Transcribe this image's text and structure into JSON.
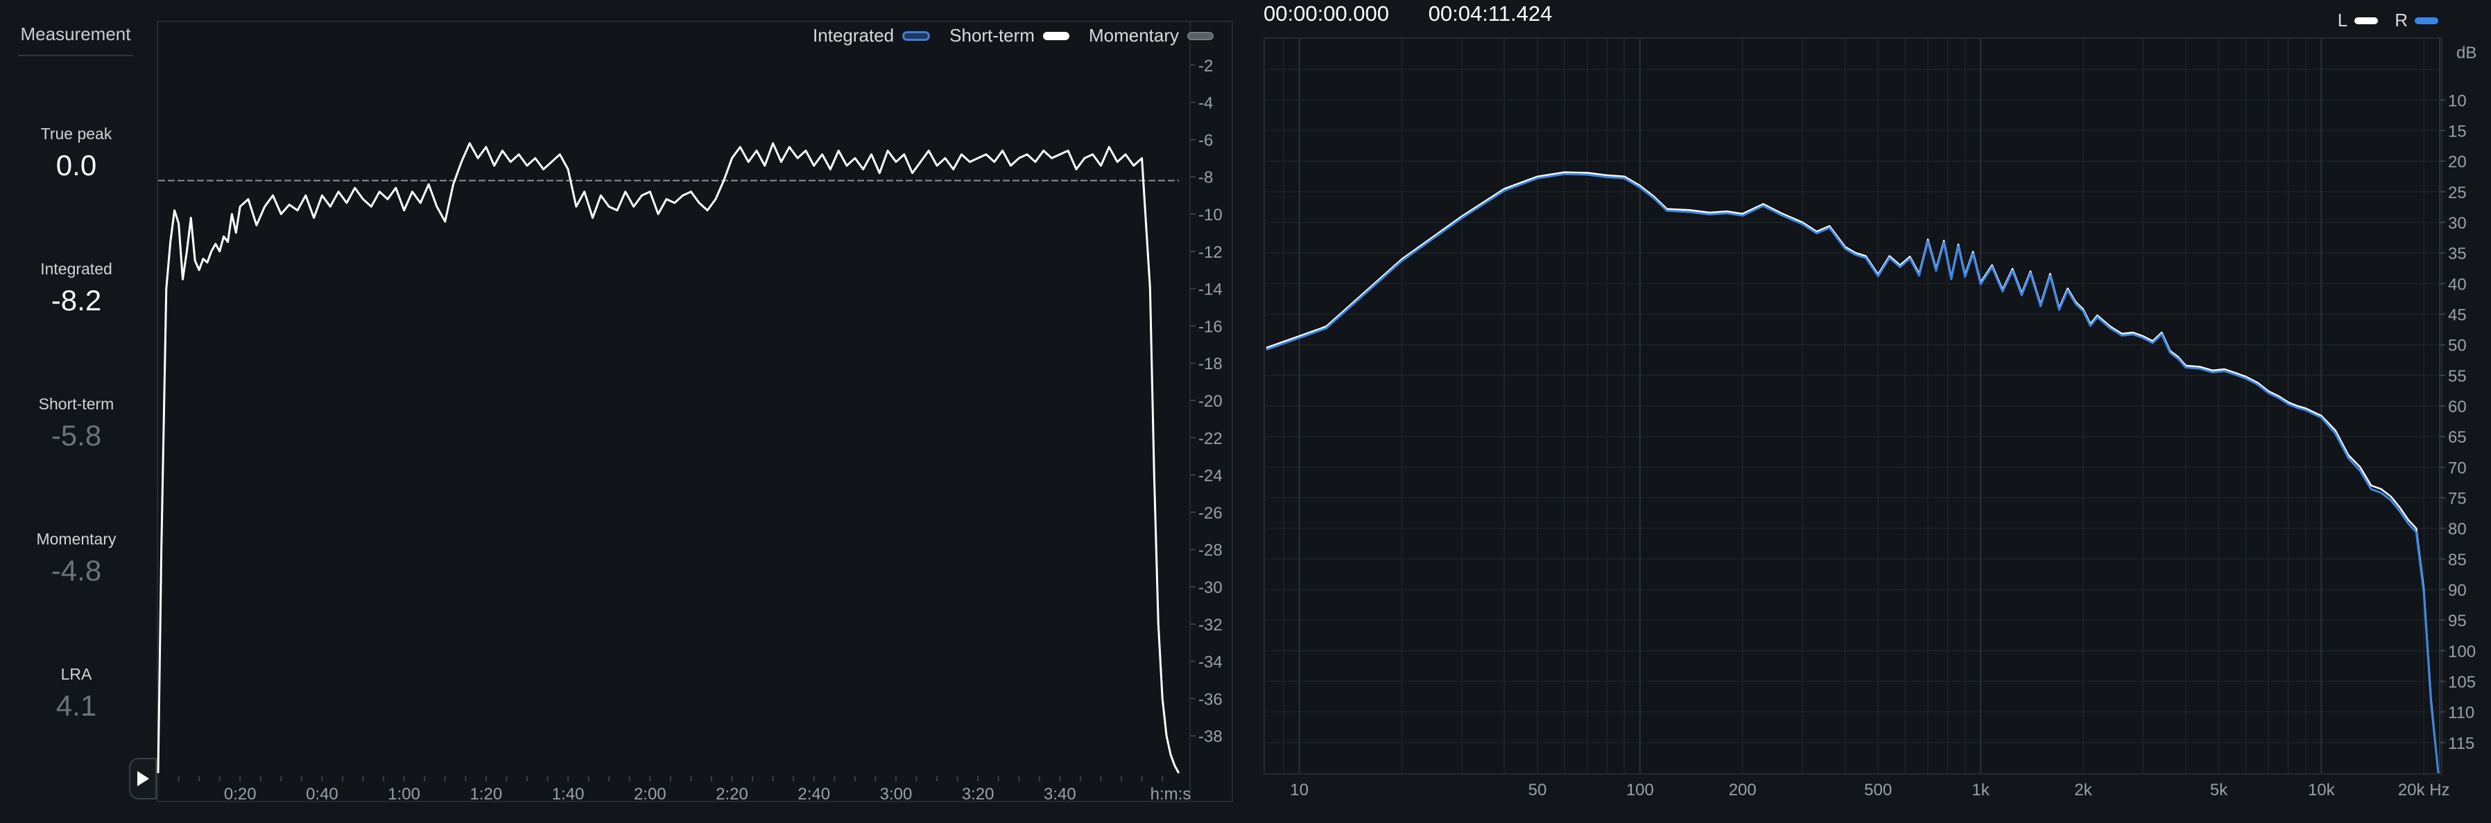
{
  "sidebar": {
    "title": "Measurement",
    "metrics": [
      {
        "label": "True peak",
        "value": "0.0"
      },
      {
        "label": "Integrated",
        "value": "-8.2"
      },
      {
        "label": "Short-term",
        "value": "-5.8"
      },
      {
        "label": "Momentary",
        "value": "-4.8"
      },
      {
        "label": "LRA",
        "value": "4.1"
      }
    ]
  },
  "loudness_legend": {
    "integrated": "Integrated",
    "short_term": "Short-term",
    "momentary": "Momentary"
  },
  "timecodes": {
    "start": "00:00:00.000",
    "end": "00:04:11.424"
  },
  "spectrum_legend": {
    "left": "L",
    "right": "R"
  },
  "colors": {
    "background": "#121519",
    "short_term_line": "#ffffff",
    "channel_l": "#ffffff",
    "channel_r": "#3b86e6",
    "integrated": "#3f7fd6",
    "momentary": "#737a82"
  },
  "icons": {
    "play": "play-icon"
  },
  "chart_data": [
    {
      "type": "line",
      "name": "loudness-history",
      "x_unit_label": "h:m:s",
      "x_tick_labels": [
        "0:20",
        "0:40",
        "1:00",
        "1:20",
        "1:40",
        "2:00",
        "2:20",
        "2:40",
        "3:00",
        "3:20",
        "3:40"
      ],
      "x_tick_seconds": [
        20,
        40,
        60,
        80,
        100,
        120,
        140,
        160,
        180,
        200,
        220
      ],
      "xlim_seconds": [
        0,
        251.4
      ],
      "y_ticks": [
        -2,
        -4,
        -6,
        -8,
        -10,
        -12,
        -14,
        -16,
        -18,
        -20,
        -22,
        -24,
        -26,
        -28,
        -30,
        -32,
        -34,
        -36,
        -38
      ],
      "ylim": [
        0,
        -40
      ],
      "integrated_reference": -8.2,
      "series": [
        {
          "x": [
            0,
            0.8,
            2,
            3,
            4,
            5,
            6,
            7,
            8,
            9,
            10,
            11,
            12,
            13,
            14,
            15,
            16,
            17,
            18,
            19,
            20,
            22,
            24,
            26,
            28,
            30,
            32,
            34,
            36,
            38,
            40,
            42,
            44,
            46,
            48,
            50,
            52,
            54,
            56,
            58,
            60,
            62,
            64,
            66,
            68,
            70,
            72,
            74,
            76,
            78,
            80,
            82,
            84,
            86,
            88,
            90,
            92,
            94,
            96,
            98,
            100,
            102,
            104,
            106,
            108,
            110,
            112,
            114,
            116,
            118,
            120,
            122,
            124,
            126,
            128,
            130,
            132,
            134,
            136,
            138,
            140,
            142,
            144,
            146,
            148,
            150,
            152,
            154,
            156,
            158,
            160,
            162,
            164,
            166,
            168,
            170,
            172,
            174,
            176,
            178,
            180,
            182,
            184,
            186,
            188,
            190,
            192,
            194,
            196,
            198,
            200,
            202,
            204,
            206,
            208,
            210,
            212,
            214,
            216,
            218,
            220,
            222,
            224,
            226,
            228,
            230,
            232,
            234,
            236,
            238,
            240,
            242,
            243,
            244,
            245,
            246,
            247,
            248,
            249
          ],
          "y": [
            -40,
            -28,
            -14,
            -11.5,
            -9.8,
            -10.5,
            -13.5,
            -12,
            -10.2,
            -12.5,
            -13,
            -12.4,
            -12.6,
            -12,
            -11.6,
            -12,
            -11.2,
            -11.5,
            -10,
            -11,
            -9.6,
            -9.2,
            -10.6,
            -9.6,
            -9,
            -10,
            -9.5,
            -9.8,
            -9,
            -10.2,
            -9,
            -9.6,
            -8.8,
            -9.4,
            -8.6,
            -9.2,
            -9.6,
            -8.8,
            -9.2,
            -8.6,
            -9.8,
            -8.8,
            -9.4,
            -8.4,
            -9.6,
            -10.4,
            -8.4,
            -7.2,
            -6.2,
            -7,
            -6.4,
            -7.4,
            -6.6,
            -7.2,
            -6.8,
            -7.4,
            -7,
            -7.6,
            -7.2,
            -6.8,
            -7.6,
            -9.6,
            -8.8,
            -10.2,
            -9,
            -9.6,
            -9.8,
            -8.8,
            -9.6,
            -9,
            -8.8,
            -10,
            -9.2,
            -9.4,
            -9,
            -8.8,
            -9.4,
            -9.8,
            -9.2,
            -8.2,
            -7,
            -6.4,
            -7.2,
            -6.6,
            -7.4,
            -6.2,
            -7.2,
            -6.4,
            -7,
            -6.6,
            -7.4,
            -6.8,
            -7.6,
            -6.6,
            -7.4,
            -7,
            -7.6,
            -6.8,
            -7.8,
            -6.6,
            -7.2,
            -6.8,
            -7.8,
            -7.2,
            -6.6,
            -7.4,
            -7,
            -7.6,
            -6.8,
            -7.2,
            -7,
            -6.8,
            -7.2,
            -6.6,
            -7.4,
            -7,
            -6.8,
            -7.2,
            -6.6,
            -7,
            -6.8,
            -6.6,
            -7.6,
            -7,
            -6.8,
            -7.4,
            -6.4,
            -7.2,
            -6.8,
            -7.4,
            -7,
            -14,
            -24,
            -32,
            -36,
            -38,
            -39,
            -39.6,
            -40
          ]
        }
      ]
    },
    {
      "type": "line",
      "name": "frequency-spectrum",
      "x_scale": "log",
      "x_tick_labels": [
        "10",
        "50",
        "100",
        "200",
        "500",
        "1k",
        "2k",
        "5k",
        "10k",
        "20k Hz"
      ],
      "x_tick_values": [
        10,
        50,
        100,
        200,
        500,
        1000,
        2000,
        5000,
        10000,
        20000
      ],
      "xlim": [
        8,
        22050
      ],
      "y_unit_label": "dB",
      "y_ticks": [
        10,
        15,
        20,
        25,
        30,
        35,
        40,
        45,
        50,
        55,
        60,
        65,
        70,
        75,
        80,
        85,
        90,
        95,
        100,
        105,
        110,
        115
      ],
      "ylim": [
        0,
        -120
      ],
      "series": [
        {
          "name": "L",
          "x": [
            8,
            12,
            20,
            30,
            40,
            50,
            60,
            70,
            80,
            90,
            100,
            110,
            120,
            140,
            160,
            180,
            200,
            230,
            260,
            300,
            330,
            360,
            400,
            430,
            460,
            500,
            540,
            580,
            620,
            660,
            700,
            740,
            780,
            820,
            860,
            900,
            950,
            1000,
            1080,
            1160,
            1240,
            1320,
            1400,
            1500,
            1600,
            1700,
            1800,
            1900,
            2000,
            2100,
            2200,
            2400,
            2600,
            2800,
            3000,
            3200,
            3400,
            3600,
            3800,
            4000,
            4400,
            4800,
            5200,
            5600,
            6000,
            6500,
            7000,
            7500,
            8000,
            8500,
            9000,
            10000,
            11000,
            12000,
            13000,
            14000,
            15000,
            16000,
            17000,
            18000,
            19000,
            20000,
            21000,
            22050
          ],
          "y": [
            -50.5,
            -47,
            -36,
            -29,
            -24.5,
            -22.5,
            -21.8,
            -21.9,
            -22.3,
            -22.5,
            -24,
            -25.8,
            -27.8,
            -28,
            -28.4,
            -28.2,
            -28.6,
            -27,
            -28.5,
            -30,
            -31.5,
            -30.6,
            -34,
            -35,
            -35.5,
            -38.5,
            -35.5,
            -37,
            -35.6,
            -38.4,
            -32.8,
            -37.6,
            -33,
            -39,
            -33.6,
            -38.6,
            -34.8,
            -39.8,
            -37,
            -41,
            -37.6,
            -41.6,
            -38,
            -43.4,
            -38.4,
            -44,
            -40.8,
            -43,
            -44.2,
            -46.6,
            -45.2,
            -47,
            -48.2,
            -48,
            -48.6,
            -49.4,
            -48,
            -51,
            -52,
            -53.4,
            -53.6,
            -54.2,
            -54,
            -54.6,
            -55.2,
            -56.2,
            -57.6,
            -58.4,
            -59.4,
            -60,
            -60.4,
            -61.6,
            -64,
            -68,
            -70,
            -73,
            -73.6,
            -74.8,
            -76.6,
            -78.6,
            -80,
            -90,
            -108,
            -120
          ]
        },
        {
          "name": "R",
          "x": [
            8,
            12,
            20,
            30,
            40,
            50,
            60,
            70,
            80,
            90,
            100,
            110,
            120,
            140,
            160,
            180,
            200,
            230,
            260,
            300,
            330,
            360,
            400,
            430,
            460,
            500,
            540,
            580,
            620,
            660,
            700,
            740,
            780,
            820,
            860,
            900,
            950,
            1000,
            1080,
            1160,
            1240,
            1320,
            1400,
            1500,
            1600,
            1700,
            1800,
            1900,
            2000,
            2100,
            2200,
            2400,
            2600,
            2800,
            3000,
            3200,
            3400,
            3600,
            3800,
            4000,
            4400,
            4800,
            5200,
            5600,
            6000,
            6500,
            7000,
            7500,
            8000,
            8500,
            9000,
            10000,
            11000,
            12000,
            13000,
            14000,
            15000,
            16000,
            17000,
            18000,
            19000,
            20000,
            21000,
            22050
          ],
          "y": [
            -50.8,
            -47.3,
            -36.3,
            -29.3,
            -24.8,
            -22.8,
            -22.1,
            -22.2,
            -22.6,
            -22.8,
            -24.3,
            -26.1,
            -28.1,
            -28.3,
            -28.7,
            -28.5,
            -28.9,
            -27.3,
            -28.8,
            -30.3,
            -31.8,
            -30.9,
            -34.3,
            -35.3,
            -35.8,
            -38.8,
            -35.8,
            -37.3,
            -35.9,
            -38.7,
            -33.1,
            -37.9,
            -33.3,
            -39.3,
            -33.9,
            -38.9,
            -35.1,
            -40.1,
            -37.3,
            -41.3,
            -37.9,
            -41.9,
            -38.3,
            -43.7,
            -38.7,
            -44.3,
            -41.1,
            -43.3,
            -44.5,
            -46.9,
            -45.5,
            -47.3,
            -48.5,
            -48.3,
            -48.9,
            -49.7,
            -48.3,
            -51.3,
            -52.3,
            -53.7,
            -53.9,
            -54.5,
            -54.3,
            -54.9,
            -55.5,
            -56.5,
            -57.9,
            -58.7,
            -59.7,
            -60.3,
            -60.7,
            -61.9,
            -64.5,
            -68.5,
            -70.6,
            -73.6,
            -74.2,
            -75.4,
            -77.2,
            -79.2,
            -80.6,
            -90.6,
            -108.6,
            -120
          ]
        }
      ]
    }
  ]
}
